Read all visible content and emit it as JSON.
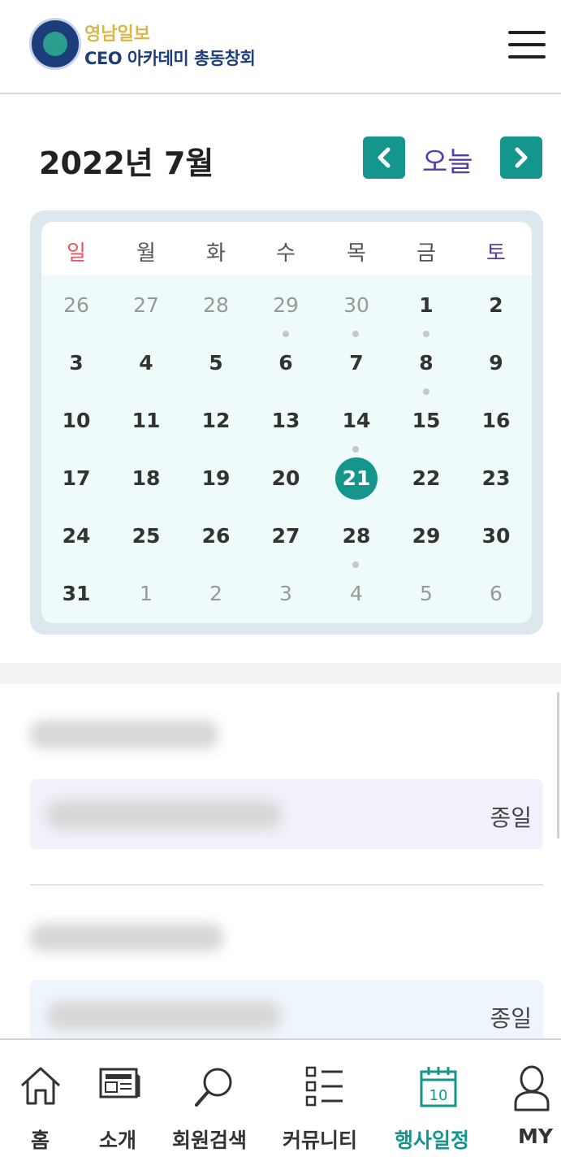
{
  "header": {
    "logo_text_top": "영남일보",
    "logo_text_bottom": "CEO 아카데미 총동창회"
  },
  "calendar": {
    "title": "2022년 7월",
    "today_label": "오늘",
    "weekdays": [
      "일",
      "월",
      "화",
      "수",
      "목",
      "금",
      "토"
    ],
    "weeks": [
      [
        "26",
        "27",
        "28",
        "29",
        "30",
        "1",
        "2"
      ],
      [
        "3",
        "4",
        "5",
        "6",
        "7",
        "8",
        "9"
      ],
      [
        "10",
        "11",
        "12",
        "13",
        "14",
        "15",
        "16"
      ],
      [
        "17",
        "18",
        "19",
        "20",
        "21",
        "22",
        "23"
      ],
      [
        "24",
        "25",
        "26",
        "27",
        "28",
        "29",
        "30"
      ],
      [
        "31",
        "1",
        "2",
        "3",
        "4",
        "5",
        "6"
      ]
    ],
    "selected_day": "21"
  },
  "events": [
    {
      "time_label": "종일"
    },
    {
      "time_label": "종일"
    }
  ],
  "colors": {
    "accent": "#14968c",
    "today_text": "#5a3aa6",
    "sunday": "#e05b5b",
    "saturday": "#5a3aa6"
  },
  "bottom_nav": [
    {
      "label": "홈",
      "icon": "home-icon"
    },
    {
      "label": "소개",
      "icon": "newspaper-icon"
    },
    {
      "label": "회원검색",
      "icon": "search-icon"
    },
    {
      "label": "커뮤니티",
      "icon": "list-icon"
    },
    {
      "label": "행사일정",
      "icon": "calendar-icon",
      "active": true
    },
    {
      "label": "MY",
      "icon": "user-icon"
    }
  ]
}
